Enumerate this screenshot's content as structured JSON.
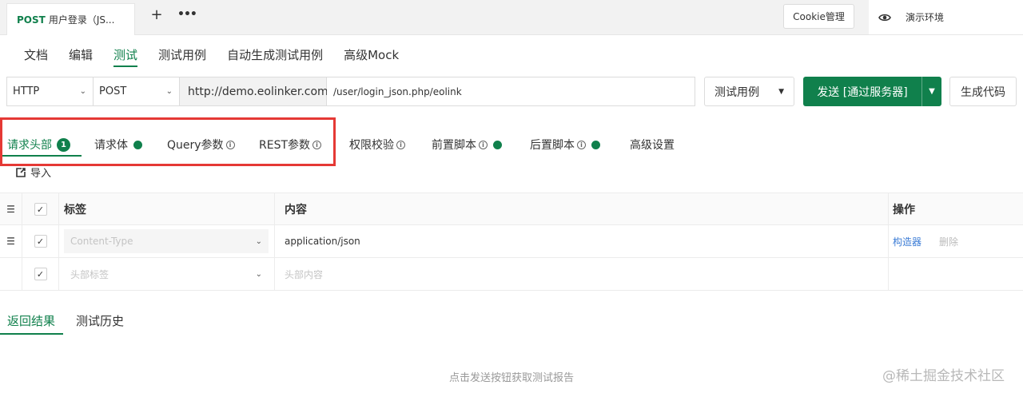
{
  "top_tabs": {
    "api_tab": {
      "method": "POST",
      "title": "用户登录（JS..."
    },
    "add_icon": "plus-icon",
    "more_icon": "more-icon",
    "cookie_button": "Cookie管理",
    "environment": {
      "icon": "eye-icon",
      "label": "演示环境"
    }
  },
  "mode_tabs": [
    {
      "label": "文档",
      "active": false
    },
    {
      "label": "编辑",
      "active": false
    },
    {
      "label": "测试",
      "active": true
    },
    {
      "label": "测试用例",
      "active": false
    },
    {
      "label": "自动生成测试用例",
      "active": false
    },
    {
      "label": "高级Mock",
      "active": false
    }
  ],
  "request": {
    "protocol": "HTTP",
    "method": "POST",
    "host": "http://demo.eolinker.com",
    "path": "/user/login_json.php/eolink",
    "test_case_button": "测试用例",
    "send_button": "发送 [通过服务器]",
    "generate_code_button": "生成代码"
  },
  "sub_tabs": [
    {
      "label": "请求头部",
      "badge": "1",
      "active": true
    },
    {
      "label": "请求体",
      "dot": true
    },
    {
      "label": "Query参数",
      "info": true
    },
    {
      "label": "REST参数",
      "info": true
    },
    {
      "label": "权限校验",
      "info": true
    },
    {
      "label": "前置脚本",
      "info": true,
      "dot": true
    },
    {
      "label": "后置脚本",
      "info": true,
      "dot": true
    },
    {
      "label": "高级设置"
    }
  ],
  "info_glyph": "i",
  "import_label": "导入",
  "headers_table": {
    "columns": {
      "label": "标签",
      "content": "内容",
      "ops": "操作"
    },
    "rows": [
      {
        "key": "Content-Type",
        "value": "application/json",
        "checked": true,
        "op_edit": "构造器",
        "op_delete": "删除"
      },
      {
        "key_placeholder": "头部标签",
        "value_placeholder": "头部内容",
        "checked": true
      }
    ]
  },
  "result_tabs": [
    {
      "label": "返回结果",
      "active": true
    },
    {
      "label": "测试历史",
      "active": false
    }
  ],
  "empty_hint": "点击发送按钮获取测试报告",
  "watermark": "@稀土掘金技术社区",
  "colors": {
    "accent": "#10804c",
    "highlight_box": "#e53935",
    "link": "#3a7bd5"
  }
}
